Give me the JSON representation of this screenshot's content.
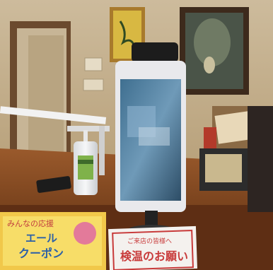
{
  "photo": {
    "left_sign": {
      "line1": "みんなの応援",
      "line2": "エール",
      "line3": "クーポン"
    },
    "right_sign": {
      "line1": "ご来店の皆様へ",
      "line2": "検温のお願い"
    }
  }
}
